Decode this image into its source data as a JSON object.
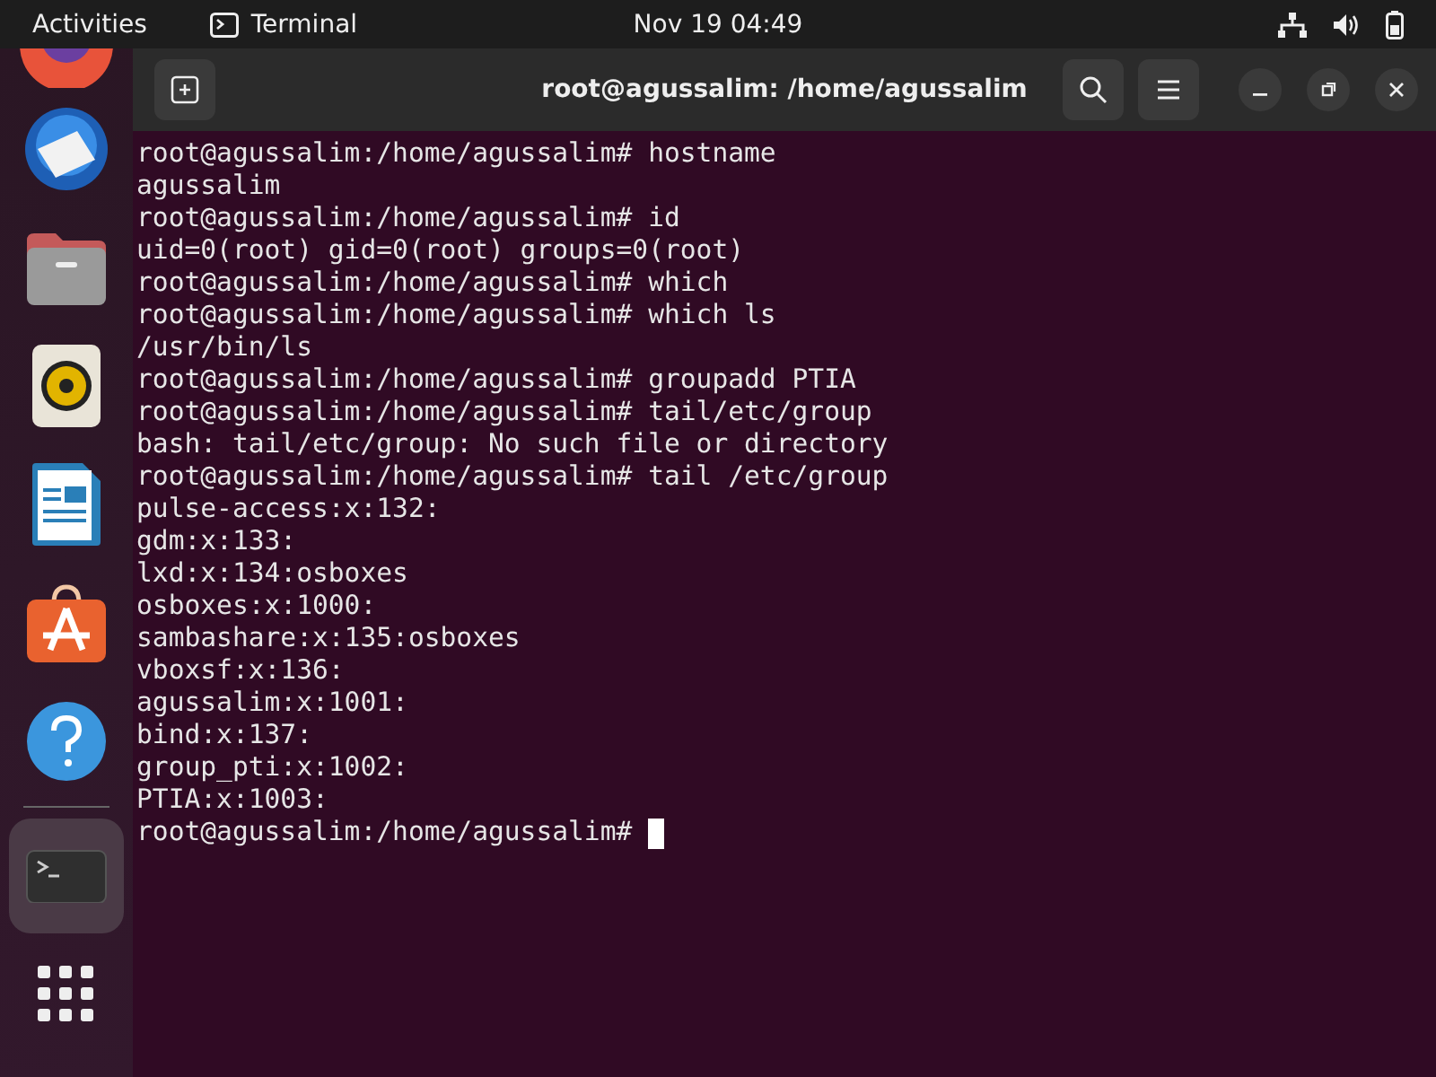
{
  "top_bar": {
    "activities": "Activities",
    "app_name": "Terminal",
    "clock": "Nov 19  04:49"
  },
  "dock": {
    "items": [
      {
        "kind": "browser",
        "selected": false
      },
      {
        "kind": "mail",
        "selected": false
      },
      {
        "kind": "files",
        "selected": false
      },
      {
        "kind": "music",
        "selected": false
      },
      {
        "kind": "writer",
        "selected": false
      },
      {
        "kind": "store",
        "selected": false
      },
      {
        "kind": "help",
        "selected": false
      },
      {
        "kind": "terminal",
        "selected": true
      }
    ]
  },
  "window": {
    "title": "root@agussalim: /home/agussalim",
    "lines": [
      "root@agussalim:/home/agussalim# hostname",
      "agussalim",
      "root@agussalim:/home/agussalim# id",
      "uid=0(root) gid=0(root) groups=0(root)",
      "root@agussalim:/home/agussalim# which",
      "root@agussalim:/home/agussalim# which ls",
      "/usr/bin/ls",
      "root@agussalim:/home/agussalim# groupadd PTIA",
      "root@agussalim:/home/agussalim# tail/etc/group",
      "bash: tail/etc/group: No such file or directory",
      "root@agussalim:/home/agussalim# tail /etc/group",
      "pulse-access:x:132:",
      "gdm:x:133:",
      "lxd:x:134:osboxes",
      "osboxes:x:1000:",
      "sambashare:x:135:osboxes",
      "vboxsf:x:136:",
      "agussalim:x:1001:",
      "bind:x:137:",
      "group_pti:x:1002:",
      "PTIA:x:1003:"
    ],
    "prompt": "root@agussalim:/home/agussalim# "
  }
}
